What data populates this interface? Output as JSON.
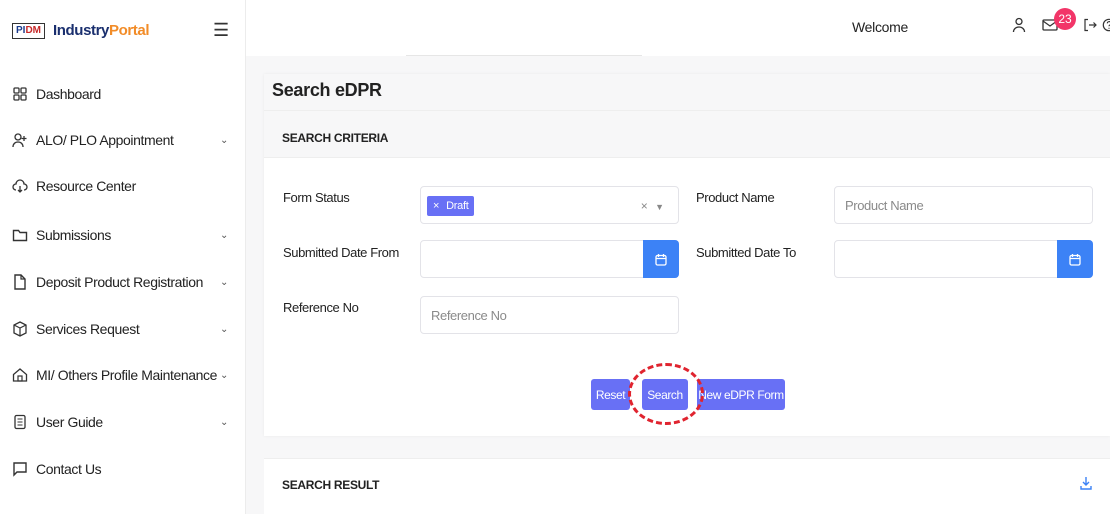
{
  "brand": {
    "logo_part1": "PI",
    "logo_part2": "DM",
    "name_part1": "Industry",
    "name_part2": "Portal"
  },
  "sidebar": {
    "items": [
      {
        "label": "Dashboard",
        "icon": "grid-icon",
        "expandable": false
      },
      {
        "label": "ALO/ PLO Appointment",
        "icon": "user-plus-icon",
        "expandable": true
      },
      {
        "label": "Resource Center",
        "icon": "cloud-icon",
        "expandable": false
      },
      {
        "label": "Submissions",
        "icon": "folder-icon",
        "expandable": true
      },
      {
        "label": "Deposit Product Registration",
        "icon": "document-icon",
        "expandable": true
      },
      {
        "label": "Services Request",
        "icon": "box-icon",
        "expandable": true
      },
      {
        "label": "MI/ Others Profile Maintenance",
        "icon": "home-icon",
        "expandable": true
      },
      {
        "label": "User Guide",
        "icon": "book-icon",
        "expandable": true
      },
      {
        "label": "Contact Us",
        "icon": "chat-icon",
        "expandable": false
      }
    ]
  },
  "header": {
    "welcome": "Welcome",
    "notification_count": "23"
  },
  "page": {
    "title": "Search eDPR",
    "criteria_title": "SEARCH CRITERIA",
    "result_title": "SEARCH RESULT"
  },
  "form": {
    "form_status_label": "Form Status",
    "form_status_tag": "Draft",
    "product_name_label": "Product Name",
    "product_name_placeholder": "Product Name",
    "submitted_from_label": "Submitted Date From",
    "submitted_to_label": "Submitted Date To",
    "reference_label": "Reference No",
    "reference_placeholder": "Reference No"
  },
  "buttons": {
    "reset": "Reset",
    "search": "Search",
    "new_form": "New eDPR Form"
  },
  "colors": {
    "primary_button": "#6870f5",
    "calendar_button": "#3c82f6",
    "badge": "#f23568",
    "highlight": "#e0242f",
    "brand_navy": "#1a2f6e",
    "brand_orange": "#f28c28"
  }
}
